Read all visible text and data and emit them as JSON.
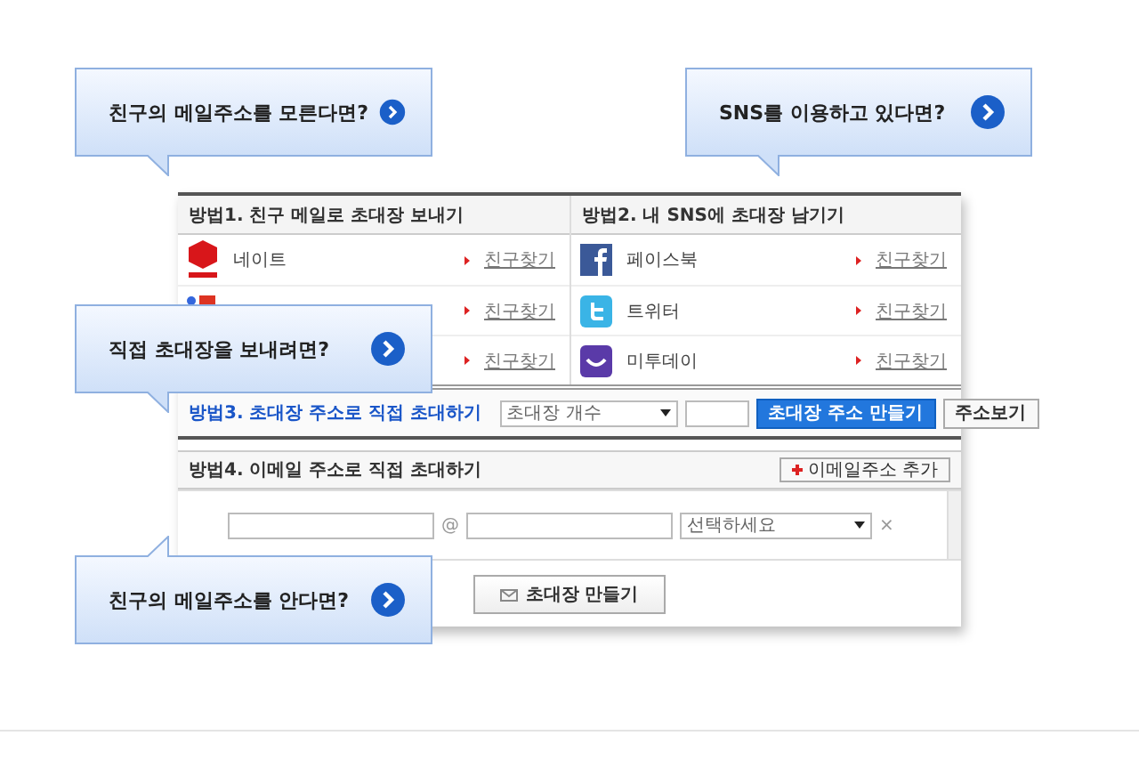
{
  "method1": {
    "title": "방법1. 친구 메일로 초대장 보내기",
    "rows": [
      {
        "kind": "nate",
        "name": "네이트",
        "link": "친구찾기"
      },
      {
        "kind": "google",
        "link": "친구찾기"
      },
      {
        "kind": "none",
        "link": "친구찾기"
      }
    ]
  },
  "method2": {
    "title": "방법2. 내 SNS에 초대장 남기기",
    "rows": [
      {
        "kind": "facebook",
        "name": "페이스북",
        "link": "친구찾기"
      },
      {
        "kind": "twitter",
        "name": "트위터",
        "link": "친구찾기"
      },
      {
        "kind": "me2day",
        "name": "미투데이",
        "link": "친구찾기"
      }
    ]
  },
  "method3": {
    "title": "방법3. 초대장 주소로 직접 초대하기",
    "select": "초대장 개수",
    "primary_button": "초대장 주소 만들기",
    "secondary_button": "주소보기"
  },
  "method4": {
    "title": "방법4. 이메일 주소로 직접 초대하기",
    "add_button": "이메일주소 추가",
    "at": "@",
    "domain_select": "선택하세요",
    "remove": "×",
    "submit": "초대장 만들기"
  },
  "callouts": [
    {
      "text": "친구의 메일주소를 모른다면?"
    },
    {
      "text": "SNS를 이용하고 있다면?"
    },
    {
      "text": "직접 초대장을 보내려면?"
    },
    {
      "text": "친구의 메일주소를 안다면?"
    }
  ]
}
